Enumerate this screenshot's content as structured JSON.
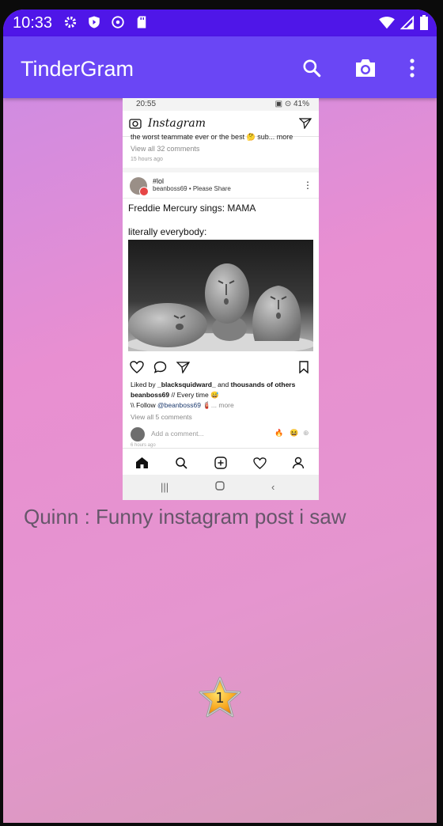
{
  "status_bar": {
    "time": "10:33"
  },
  "app_bar": {
    "title": "TinderGram"
  },
  "screenshot": {
    "status_time": "20:55",
    "status_right": "▣ ⊙ 41%",
    "app_name": "Instagram",
    "prev_snippet": "the worst teammate ever or the best 🤔 sub... more",
    "prev_view_all": "View all 32 comments",
    "prev_time": "15 hours ago",
    "post_user": "#lol",
    "post_sub": "beanboss69 • Please Share",
    "post_line1": "Freddie Mercury sings: MAMA",
    "post_line2": "literally everybody:",
    "liked_prefix": "Liked by ",
    "liked_user": "_blacksquidward_",
    "liked_mid": " and ",
    "liked_rest": "thousands of others",
    "cap_user": "beanboss69",
    "cap_text": " // Every time 😅",
    "follow_prefix": "\\\\ Follow ",
    "follow_handle": "@beanboss69",
    "follow_more": " 🧯... more",
    "view_all": "View all 5 comments",
    "add_comment": "Add a comment...",
    "time_ago": "6 hours ago",
    "emojis": [
      "🔥",
      "😆",
      "⊕"
    ]
  },
  "message": {
    "text": "Quinn : Funny instagram post i saw"
  },
  "rating": {
    "value": "1"
  }
}
